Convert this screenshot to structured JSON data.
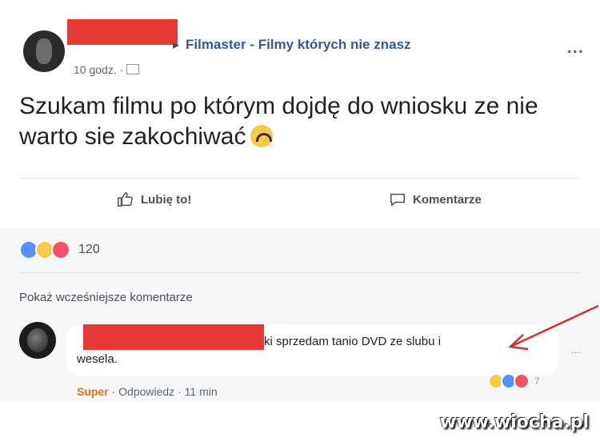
{
  "post": {
    "group_name": "Filmaster - Filmy których nie znasz",
    "time": "10 godz. ·",
    "more": "...",
    "text": "Szukam filmu po którym dojdę do wniosku ze nie warto sie zakochiwać",
    "emoji": "upside-down-face",
    "like_label": "Lubię to!",
    "comment_label": "Komentarze",
    "reaction_count": "120"
  },
  "comments": {
    "show_previous": "Pokaż wcześniejsze komentarze",
    "items": [
      {
        "text_line1": "ki sprzedam tanio DVD ze slubu i",
        "text_line2": "wesela.",
        "reaction_count": "7",
        "action_super": "Super",
        "action_reply": "Odpowiedz",
        "time": "11 min",
        "more": "..."
      }
    ]
  },
  "watermark": "www.wiocha.pl",
  "colors": {
    "redaction": "#e53935",
    "link": "#365899",
    "arrow": "#d32f2f"
  }
}
